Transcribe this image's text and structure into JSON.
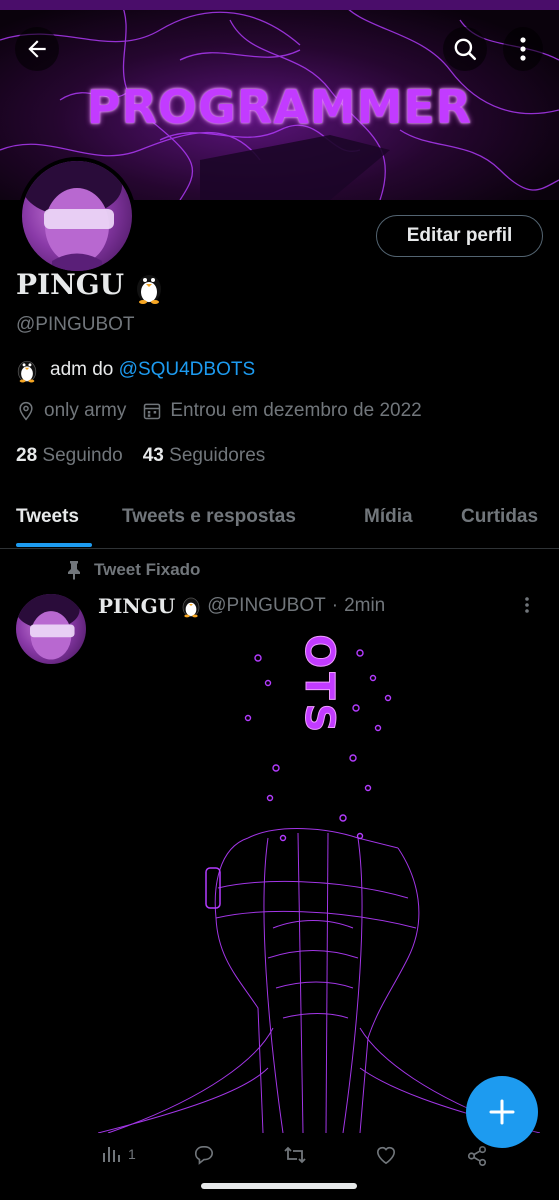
{
  "banner": {
    "text": "PROGRAMMER"
  },
  "header": {
    "back": "back-arrow-icon",
    "search": "search-icon",
    "more": "more-vertical-icon"
  },
  "profile": {
    "name": "PINGU",
    "handle": "@PINGUBOT",
    "edit_label": "Editar perfil",
    "bio_prefix": "adm do ",
    "bio_link": "@SQU4DBOTS",
    "location": "only army",
    "joined": "Entrou em dezembro de 2022",
    "following_count": "28",
    "following_label": "Seguindo",
    "followers_count": "43",
    "followers_label": "Seguidores"
  },
  "tabs": [
    "Tweets",
    "Tweets e respostas",
    "Mídia",
    "Curtidas"
  ],
  "tweet": {
    "pinned_label": "Tweet Fixado",
    "name": "PINGU",
    "handle": "@PINGUBOT",
    "sep": "·",
    "time": "2min",
    "media_text": "BOTS",
    "views": "1"
  },
  "colors": {
    "accent": "#1d9bf0",
    "purple": "#b43cff",
    "muted": "#71767b"
  }
}
